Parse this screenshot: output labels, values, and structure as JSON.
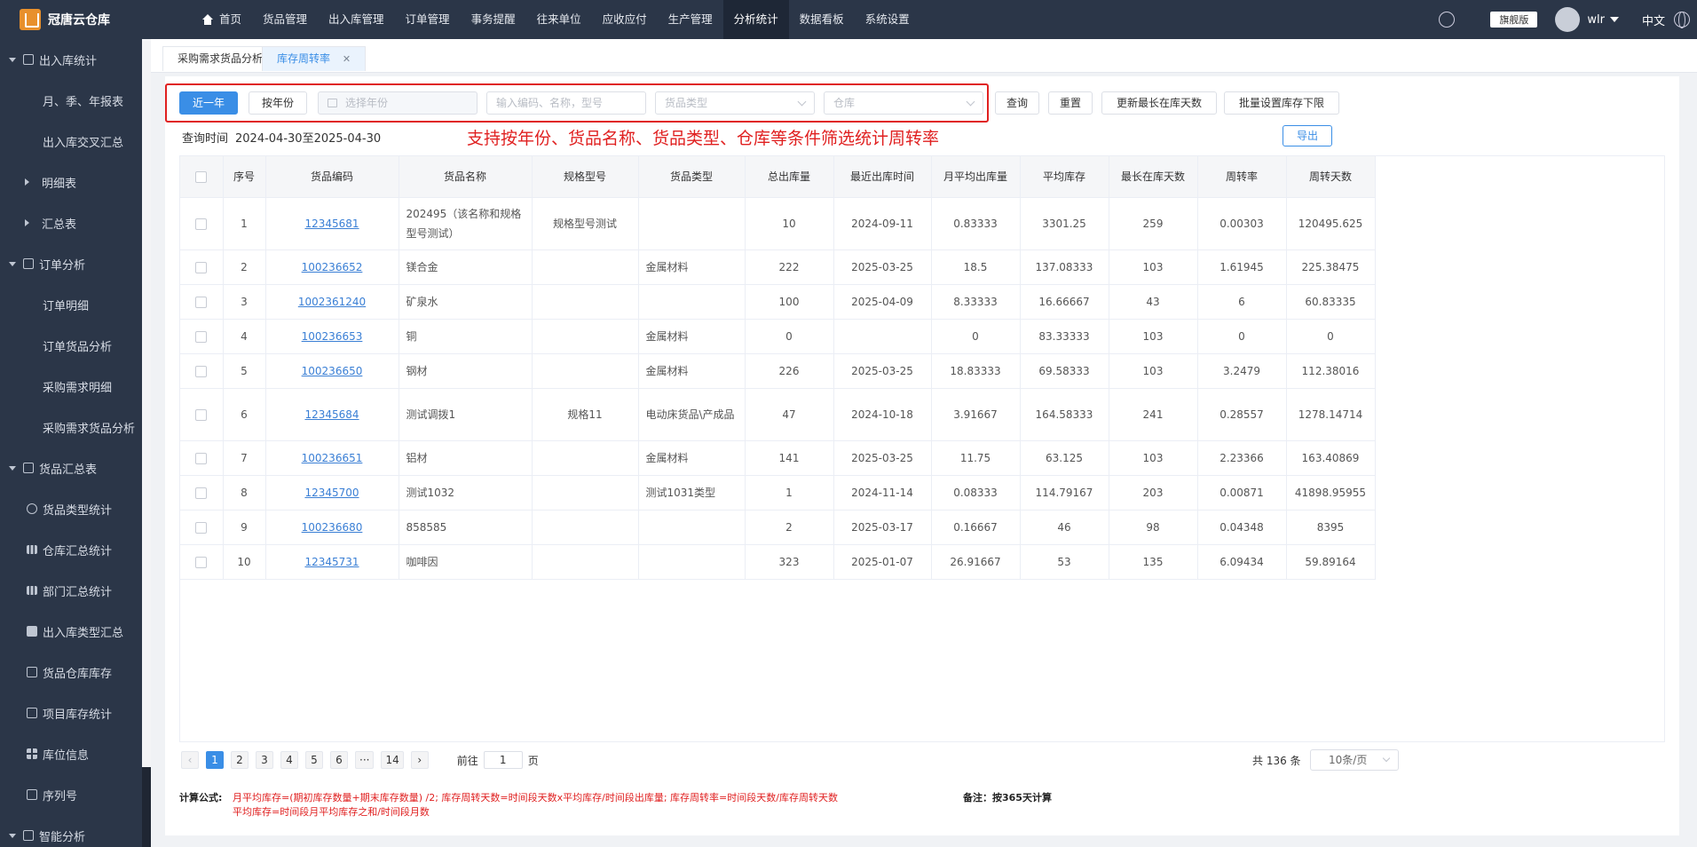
{
  "app": {
    "title": "冠唐云仓库"
  },
  "nav": {
    "items": [
      "首页",
      "货品管理",
      "出入库管理",
      "订单管理",
      "事务提醒",
      "往来单位",
      "应收应付",
      "生产管理",
      "分析统计",
      "数据看板",
      "系统设置"
    ],
    "active": "分析统计"
  },
  "header": {
    "edition": "旗舰版",
    "user": "wlr",
    "lang": "中文"
  },
  "sidebar": {
    "items": [
      {
        "label": "出入库统计",
        "level": "group"
      },
      {
        "label": "月、季、年报表",
        "level": "sub"
      },
      {
        "label": "出入库交叉汇总",
        "level": "sub"
      },
      {
        "label": "明细表",
        "level": "collapsed"
      },
      {
        "label": "汇总表",
        "level": "collapsed"
      },
      {
        "label": "订单分析",
        "level": "group"
      },
      {
        "label": "订单明细",
        "level": "sub"
      },
      {
        "label": "订单货品分析",
        "level": "sub"
      },
      {
        "label": "采购需求明细",
        "level": "sub"
      },
      {
        "label": "采购需求货品分析",
        "level": "sub"
      },
      {
        "label": "货品汇总表",
        "level": "group"
      },
      {
        "label": "货品类型统计",
        "level": "sub2",
        "icon": "pie"
      },
      {
        "label": "仓库汇总统计",
        "level": "sub2",
        "icon": "bar"
      },
      {
        "label": "部门汇总统计",
        "level": "sub2",
        "icon": "bar"
      },
      {
        "label": "出入库类型汇总",
        "level": "sub2",
        "icon": "fill"
      },
      {
        "label": "货品仓库库存",
        "level": "sub2",
        "icon": "box"
      },
      {
        "label": "项目库存统计",
        "level": "sub2",
        "icon": "box"
      },
      {
        "label": "库位信息",
        "level": "sub2",
        "icon": "grid"
      },
      {
        "label": "序列号",
        "level": "sub2",
        "icon": "box"
      },
      {
        "label": "智能分析",
        "level": "group"
      }
    ]
  },
  "tabs": [
    {
      "label": "采购需求货品分析",
      "active": false
    },
    {
      "label": "库存周转率",
      "active": true
    }
  ],
  "filters": {
    "recent_year": "近一年",
    "by_year": "按年份",
    "year_placeholder": "选择年份",
    "keyword_placeholder": "输入编码、名称，型号",
    "type_placeholder": "货品类型",
    "warehouse_placeholder": "仓库",
    "query": "查询",
    "reset": "重置",
    "update_longest": "更新最长在库天数",
    "batch_set_min": "批量设置库存下限"
  },
  "query_time": {
    "label": "查询时间",
    "value": "2024-04-30至2025-04-30"
  },
  "annotation": "支持按年份、货品名称、货品类型、仓库等条件筛选统计周转率",
  "export": "导出",
  "table": {
    "headers": [
      "序号",
      "货品编码",
      "货品名称",
      "规格型号",
      "货品类型",
      "总出库量",
      "最近出库时间",
      "月平均出库量",
      "平均库存",
      "最长在库天数",
      "周转率",
      "周转天数"
    ],
    "rows": [
      [
        "1",
        "12345681",
        "202495（该名称和规格型号测试）",
        "规格型号测试",
        "",
        "10",
        "2024-09-11",
        "0.83333",
        "3301.25",
        "259",
        "0.00303",
        "120495.625"
      ],
      [
        "2",
        "100236652",
        "镁合金",
        "",
        "金属材料",
        "222",
        "2025-03-25",
        "18.5",
        "137.08333",
        "103",
        "1.61945",
        "225.38475"
      ],
      [
        "3",
        "1002361240",
        "矿泉水",
        "",
        "",
        "100",
        "2025-04-09",
        "8.33333",
        "16.66667",
        "43",
        "6",
        "60.83335"
      ],
      [
        "4",
        "100236653",
        "铜",
        "",
        "金属材料",
        "0",
        "",
        "0",
        "83.33333",
        "103",
        "0",
        "0"
      ],
      [
        "5",
        "100236650",
        "钢材",
        "",
        "金属材料",
        "226",
        "2025-03-25",
        "18.83333",
        "69.58333",
        "103",
        "3.2479",
        "112.38016"
      ],
      [
        "6",
        "12345684",
        "测试调拨1",
        "规格11",
        "电动床货品\\产成品",
        "47",
        "2024-10-18",
        "3.91667",
        "164.58333",
        "241",
        "0.28557",
        "1278.14714"
      ],
      [
        "7",
        "100236651",
        "铝材",
        "",
        "金属材料",
        "141",
        "2025-03-25",
        "11.75",
        "63.125",
        "103",
        "2.23366",
        "163.40869"
      ],
      [
        "8",
        "12345700",
        "测试1032",
        "",
        "测试1031类型",
        "1",
        "2024-11-14",
        "0.08333",
        "114.79167",
        "203",
        "0.00871",
        "41898.95955"
      ],
      [
        "9",
        "100236680",
        "858585",
        "",
        "",
        "2",
        "2025-03-17",
        "0.16667",
        "46",
        "98",
        "0.04348",
        "8395"
      ],
      [
        "10",
        "12345731",
        "咖啡因",
        "",
        "",
        "323",
        "2025-01-07",
        "26.91667",
        "53",
        "135",
        "6.09434",
        "59.89164"
      ]
    ]
  },
  "pagination": {
    "pages": [
      "1",
      "2",
      "3",
      "4",
      "5",
      "6",
      "···",
      "14"
    ],
    "current": "1",
    "goto_prefix": "前往",
    "goto_value": "1",
    "goto_suffix": "页",
    "total": "共 136 条",
    "page_size": "10条/页"
  },
  "formula": {
    "label": "计算公式:",
    "line1": "月平均库存=(期初库存数量+期末库存数量) /2; 库存周转天数=时间段天数x平均库存/时间段出库量; 库存周转率=时间段天数/库存周转天数",
    "line2": "平均库存=时间段月平均库存之和/时间段月数",
    "remark": "备注：按365天计算"
  }
}
